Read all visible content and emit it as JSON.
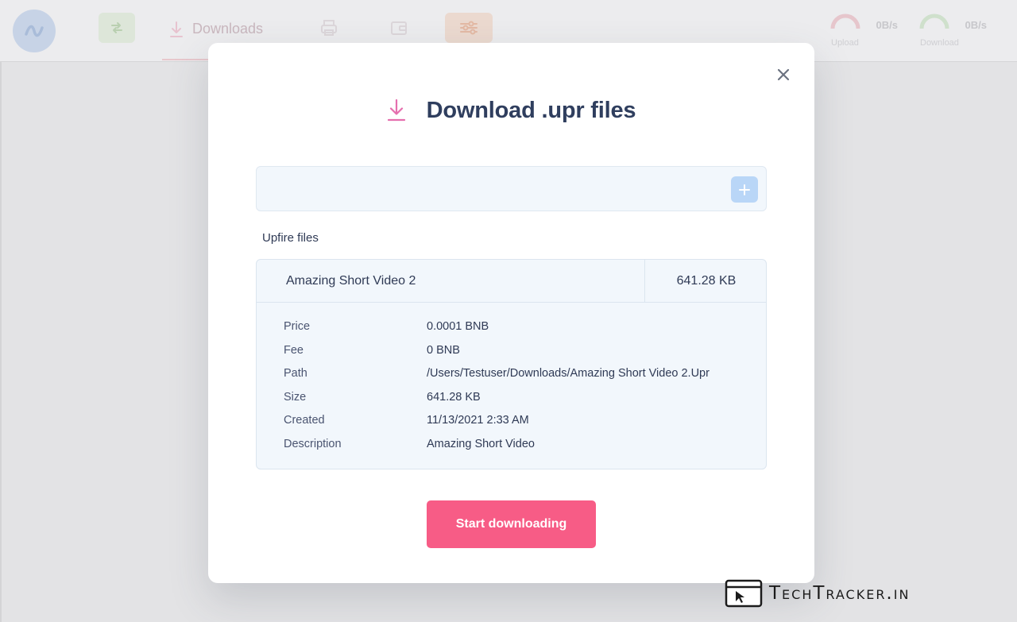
{
  "app": {
    "nav": {
      "downloads_label": "Downloads"
    },
    "speed": {
      "upload_value": "0B/s",
      "upload_label": "Upload",
      "download_value": "0B/s",
      "download_label": "Download"
    }
  },
  "modal": {
    "title": "Download .upr files",
    "input_value": "",
    "section_label": "Upfire files",
    "file": {
      "name": "Amazing Short Video 2",
      "size": "641.28 KB",
      "details": [
        {
          "label": "Price",
          "value": "0.0001 BNB"
        },
        {
          "label": "Fee",
          "value": "0 BNB"
        },
        {
          "label": "Path",
          "value": "/Users/Testuser/Downloads/Amazing Short Video 2.Upr"
        },
        {
          "label": "Size",
          "value": "641.28 KB"
        },
        {
          "label": "Created",
          "value": "11/13/2021 2:33 AM"
        },
        {
          "label": "Description",
          "value": "Amazing Short Video"
        }
      ]
    },
    "start_button_label": "Start downloading"
  },
  "watermark": {
    "text": "TechTracker.in"
  },
  "colors": {
    "accent_pink": "#f75c86",
    "icon_pink": "#e56fae",
    "title_navy": "#2f3e5e",
    "add_button_blue": "#b9d6f7"
  }
}
